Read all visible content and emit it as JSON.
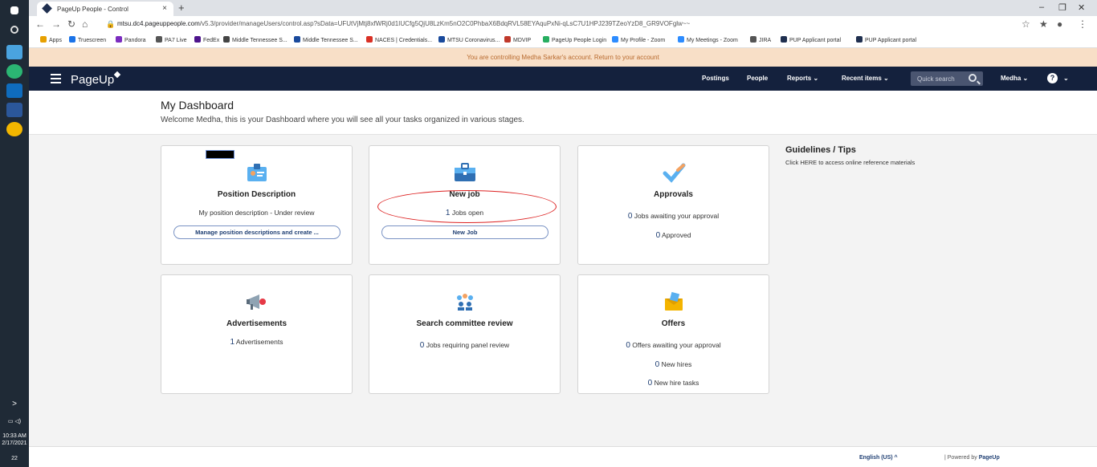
{
  "taskbar": {
    "time": "10:33 AM",
    "date": "2/17/2021",
    "notif_count": "22"
  },
  "browser": {
    "tab_title": "PageUp People - Control",
    "tab_close": "×",
    "new_tab": "+",
    "url_domain": "mtsu.dc4.pageuppeople.com",
    "url_path": "/v5.3/provider/manageUsers/control.asp?sData=UFUtVjMtj8xfWRj0d1IUCfg5QjU8LzKm5nO2C0PhbaX6BdqRVL58EYAquPxNi-qLsC7U1HPJ239TZeoYzD8_GR9VOFglw~~",
    "window_controls": [
      "–",
      "❐",
      "✕"
    ],
    "bookmarks": [
      {
        "label": "Apps",
        "color": "#e7a000"
      },
      {
        "label": "Truescreen",
        "color": "#1a73e8"
      },
      {
        "label": "Pandora",
        "color": "#7b2cbf"
      },
      {
        "label": "PA7 Live",
        "color": "#555555"
      },
      {
        "label": "FedEx",
        "color": "#4d148c"
      },
      {
        "label": "Middle Tennessee S...",
        "color": "#444444"
      },
      {
        "label": "Middle Tennessee S...",
        "color": "#1a4a9c"
      },
      {
        "label": "NACES | Credentials...",
        "color": "#d93025"
      },
      {
        "label": "MTSU Coronavirus...",
        "color": "#1a4a9c"
      },
      {
        "label": "MDVIP",
        "color": "#c0392b"
      },
      {
        "label": "PageUp People Login",
        "color": "#27ae60"
      },
      {
        "label": "My Profile - Zoom",
        "color": "#2d8cff"
      },
      {
        "label": "My Meetings - Zoom",
        "color": "#2d8cff"
      },
      {
        "label": "JIRA",
        "color": "#555555"
      },
      {
        "label": "PUP Applicant portal",
        "color": "#1f2f4f"
      },
      {
        "label": "PUP Applicant portal",
        "color": "#1f2f4f"
      }
    ]
  },
  "control_banner": "You are controlling Medha Sarkar's account. Return to your account",
  "appbar": {
    "logo": "PageUp",
    "nav": {
      "postings": "Postings",
      "people": "People",
      "reports": "Reports ⌄",
      "recent": "Recent items ⌄",
      "user": "Medha ⌄",
      "help_chevron": "⌄"
    },
    "quick_search_placeholder": "Quick search",
    "help": "?"
  },
  "dashboard": {
    "title": "My Dashboard",
    "subtitle": "Welcome Medha, this is your Dashboard where you will see all your tasks organized in various stages."
  },
  "cards": {
    "position": {
      "title": "Position Description",
      "line1": "My position description - Under review",
      "button": "Manage position descriptions and create ..."
    },
    "newjob": {
      "title": "New job",
      "count": "1",
      "line1": " Jobs open",
      "button": "New Job"
    },
    "approvals": {
      "title": "Approvals",
      "count1": "0",
      "line1": " Jobs awaiting your approval",
      "count2": "0",
      "line2": " Approved"
    },
    "ads": {
      "title": "Advertisements",
      "count": "1",
      "line1": " Advertisements"
    },
    "search": {
      "title": "Search committee review",
      "count": "0",
      "line1": " Jobs requiring panel review"
    },
    "offers": {
      "title": "Offers",
      "count1": "0",
      "line1": " Offers awaiting your approval",
      "count2": "0",
      "line2": " New hires",
      "count3": "0",
      "line3": " New hire tasks"
    }
  },
  "guidelines": {
    "title": "Guidelines / Tips",
    "link": "Click HERE to access online reference materials"
  },
  "footer": {
    "language": "English (US) ^",
    "powered_prefix": "| Powered by ",
    "powered_brand": "PageUp"
  }
}
